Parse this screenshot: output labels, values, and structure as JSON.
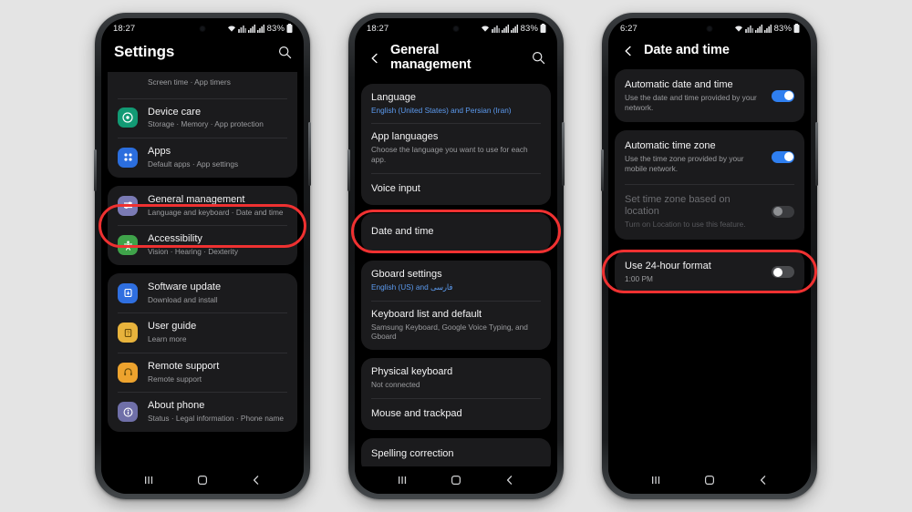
{
  "background_color": "#e4e4e4",
  "accent_colors": {
    "highlight_ring": "#ef3131",
    "toggle_on": "#2f7ff0",
    "link_blue": "#5c9bf0"
  },
  "phones": [
    {
      "id": "phone-settings",
      "status_bar": {
        "time": "18:27",
        "battery": "83%"
      },
      "app_bar": {
        "title": "Settings",
        "has_back": false,
        "has_search": true
      },
      "groups": [
        {
          "clipped_top": true,
          "rows": [
            {
              "name": "digital-wellbeing",
              "title": "",
              "sub": "Screen time  ·  App timers",
              "icon": null,
              "icon_color": null
            },
            {
              "name": "device-care",
              "title": "Device care",
              "sub": "Storage  ·  Memory  ·  App protection",
              "icon": "device-care-icon",
              "icon_color": "#129a74"
            },
            {
              "name": "apps",
              "title": "Apps",
              "sub": "Default apps  ·  App settings",
              "icon": "apps-icon",
              "icon_color": "#2b6ede"
            }
          ]
        },
        {
          "rows": [
            {
              "name": "general-management",
              "title": "General management",
              "sub": "Language and keyboard  ·  Date and time",
              "icon": "sliders-icon",
              "icon_color": "#7a7ab4",
              "highlighted": true
            },
            {
              "name": "accessibility",
              "title": "Accessibility",
              "sub": "Vision  ·  Hearing  ·  Dexterity",
              "icon": "accessibility-icon",
              "icon_color": "#3fa34a"
            }
          ]
        },
        {
          "rows": [
            {
              "name": "software-update",
              "title": "Software update",
              "sub": "Download and install",
              "icon": "software-update-icon",
              "icon_color": "#2f6fe0"
            },
            {
              "name": "user-guide",
              "title": "User guide",
              "sub": "Learn more",
              "icon": "user-guide-icon",
              "icon_color": "#e8b33c"
            },
            {
              "name": "remote-support",
              "title": "Remote support",
              "sub": "Remote support",
              "icon": "headset-icon",
              "icon_color": "#eda32e"
            },
            {
              "name": "about-phone",
              "title": "About phone",
              "sub": "Status  ·  Legal information  ·  Phone name",
              "icon": "info-icon",
              "icon_color": "#6f6fa8"
            }
          ]
        }
      ]
    },
    {
      "id": "phone-general-management",
      "status_bar": {
        "time": "18:27",
        "battery": "83%"
      },
      "app_bar": {
        "title": "General management",
        "has_back": true,
        "has_search": true
      },
      "groups": [
        {
          "rows": [
            {
              "name": "language",
              "title": "Language",
              "sub": "English (United States) and Persian (Iran)",
              "sub_style": "blue"
            },
            {
              "name": "app-languages",
              "title": "App languages",
              "sub": "Choose the language you want to use for each app."
            },
            {
              "name": "voice-input",
              "title": "Voice input",
              "sub": ""
            }
          ]
        },
        {
          "rows": [
            {
              "name": "date-and-time",
              "title": "Date and time",
              "sub": "",
              "highlighted": true
            }
          ]
        },
        {
          "rows": [
            {
              "name": "gboard-settings",
              "title": "Gboard settings",
              "sub": "English (US) and فارسی",
              "sub_style": "blue"
            },
            {
              "name": "keyboard-list-and-default",
              "title": "Keyboard list and default",
              "sub": "Samsung Keyboard, Google Voice Typing, and Gboard"
            }
          ]
        },
        {
          "rows": [
            {
              "name": "physical-keyboard",
              "title": "Physical keyboard",
              "sub": "Not connected"
            },
            {
              "name": "mouse-and-trackpad",
              "title": "Mouse and trackpad",
              "sub": ""
            }
          ]
        },
        {
          "clipped_bottom": true,
          "rows": [
            {
              "name": "spelling-correction",
              "title": "Spelling correction",
              "sub": ""
            }
          ]
        }
      ]
    },
    {
      "id": "phone-date-and-time",
      "status_bar": {
        "time": "6:27",
        "battery": "83%"
      },
      "app_bar": {
        "title": "Date and time",
        "has_back": true,
        "has_search": false
      },
      "groups": [
        {
          "rows": [
            {
              "name": "automatic-date-and-time",
              "title": "Automatic date and time",
              "sub": "Use the date and time provided by your network.",
              "toggle": "on"
            }
          ]
        },
        {
          "rows": [
            {
              "name": "automatic-time-zone",
              "title": "Automatic time zone",
              "sub": "Use the time zone provided by your mobile network.",
              "toggle": "on"
            },
            {
              "name": "set-time-zone-based-on-location",
              "title": "Set time zone based on location",
              "sub": "Turn on Location to use this feature.",
              "toggle": "off-dim",
              "disabled": true
            }
          ]
        },
        {
          "rows": [
            {
              "name": "use-24-hour-format",
              "title": "Use 24-hour format",
              "sub": "1:00 PM",
              "toggle": "off",
              "highlighted": true
            }
          ]
        }
      ]
    }
  ],
  "nav_bar": {
    "recents_label": "recents-button",
    "home_label": "home-button",
    "back_label": "back-button"
  }
}
